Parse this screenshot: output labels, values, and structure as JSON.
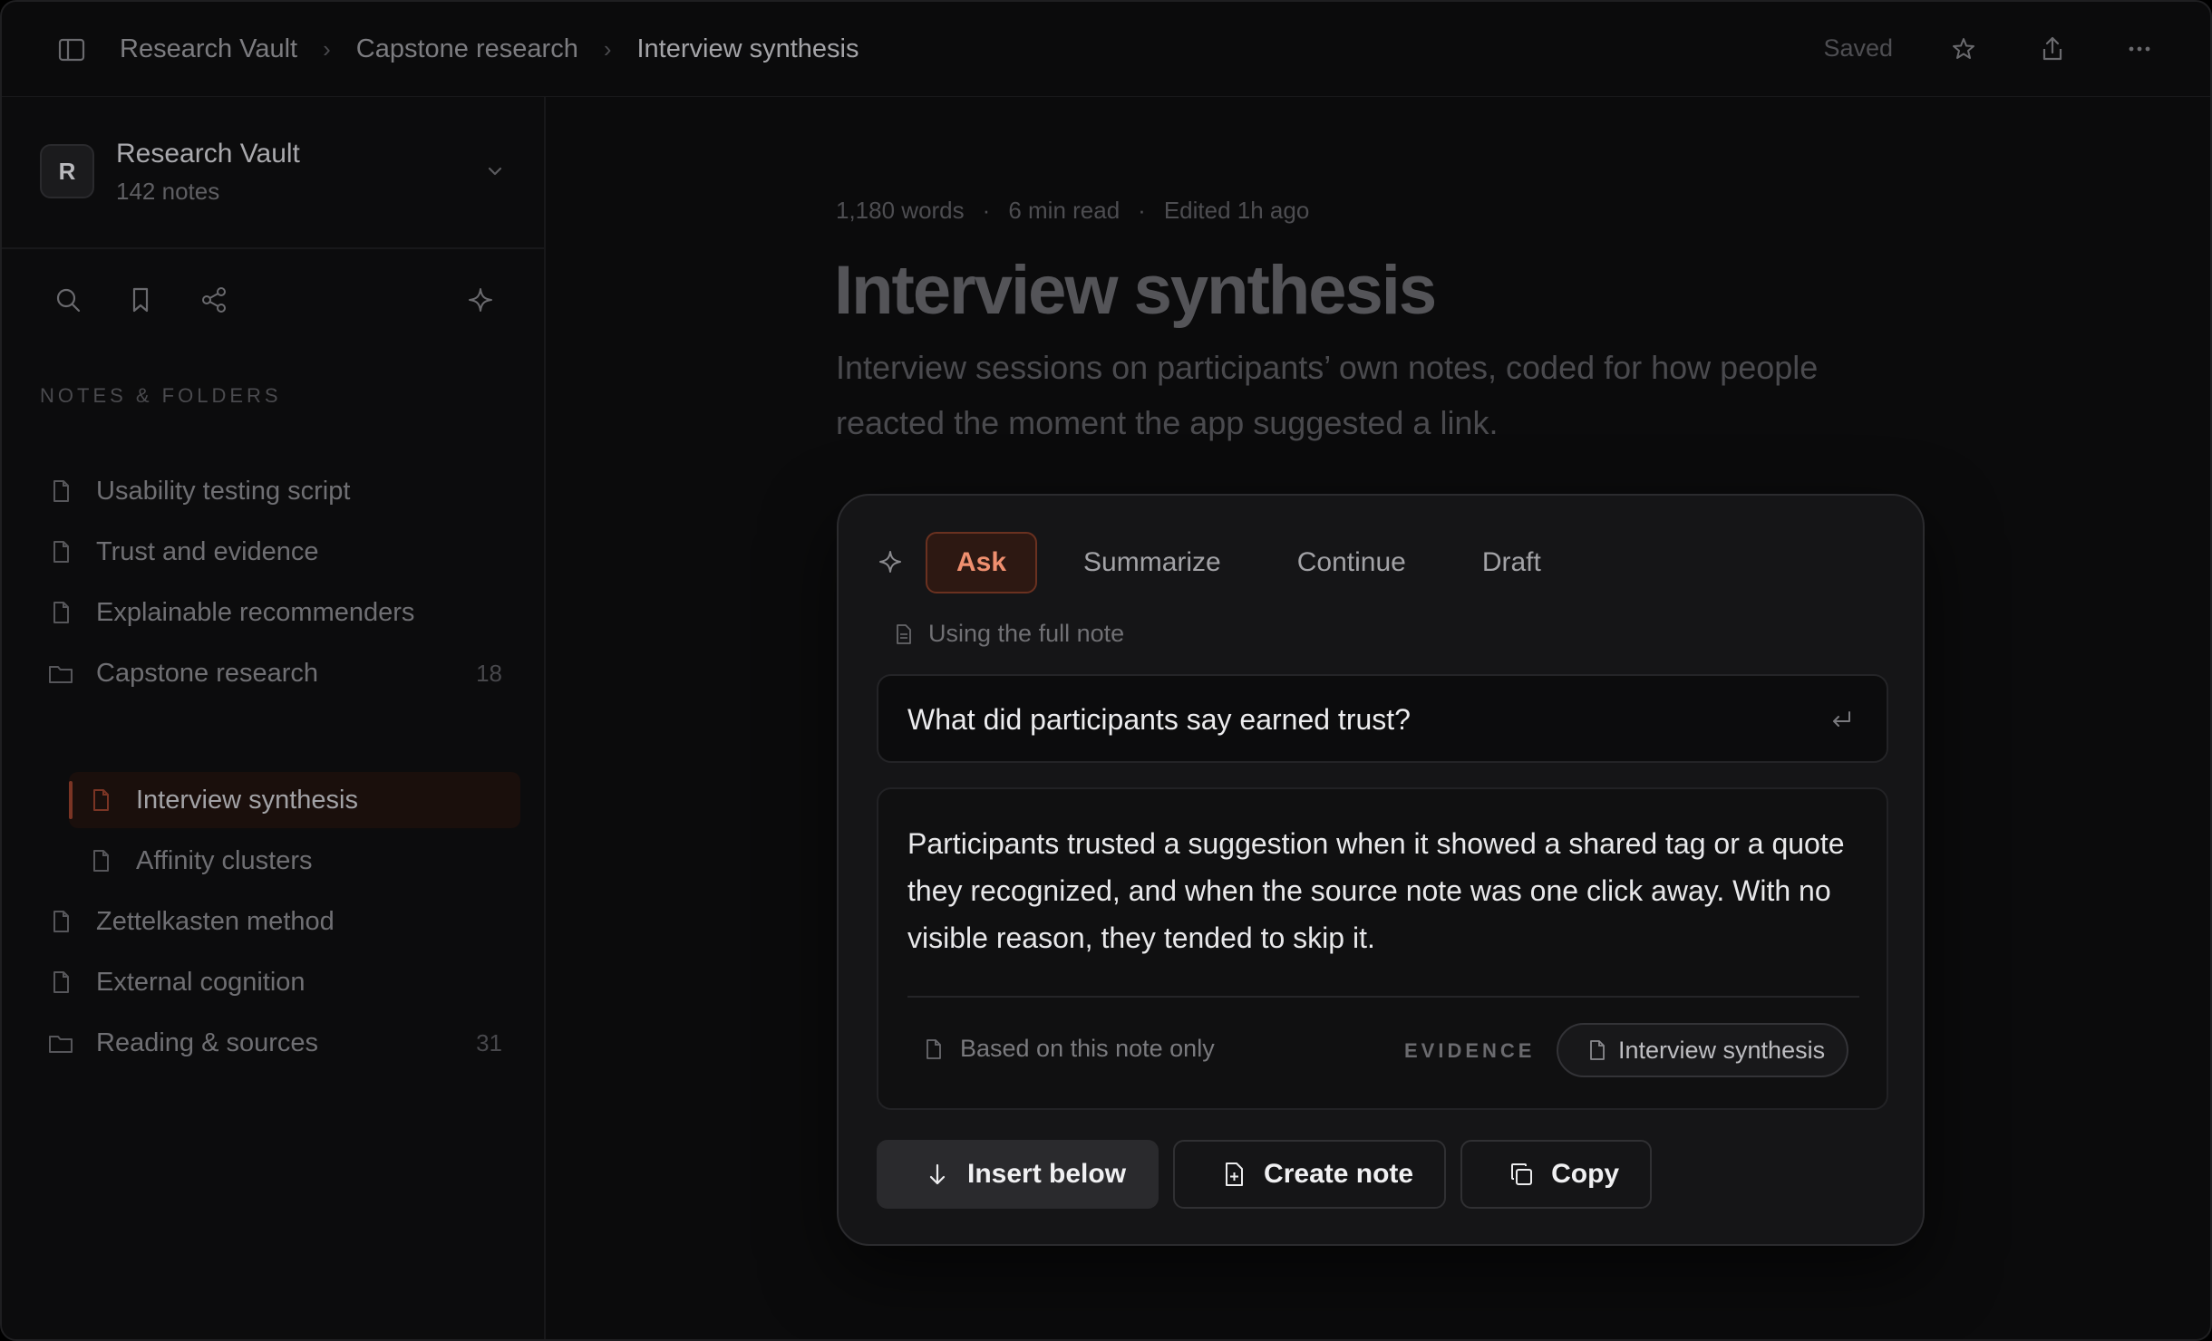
{
  "breadcrumb": [
    "Research Vault",
    "Capstone research",
    "Interview synthesis"
  ],
  "topbar": {
    "saved_label": "Saved",
    "icons": [
      "sidebar-toggle-icon",
      "star-icon",
      "share-icon",
      "more-icon"
    ]
  },
  "sidebar": {
    "vault": {
      "initial": "R",
      "name": "Research Vault",
      "count": "142 notes"
    },
    "tools": [
      "search-icon",
      "bookmark-icon",
      "graph-icon",
      "sparkle-icon"
    ],
    "section_label": "NOTES & FOLDERS",
    "items": [
      {
        "type": "note",
        "label": "Usability testing script"
      },
      {
        "type": "note",
        "label": "Trust and evidence"
      },
      {
        "type": "note",
        "label": "Explainable recommenders"
      },
      {
        "type": "folder",
        "label": "Capstone research",
        "count": "18"
      },
      {
        "type": "note",
        "label": "Interview synthesis",
        "active": true,
        "child": true
      },
      {
        "type": "note",
        "label": "Affinity clusters",
        "child": true
      },
      {
        "type": "note",
        "label": "Zettelkasten method"
      },
      {
        "type": "note",
        "label": "External cognition"
      },
      {
        "type": "folder",
        "label": "Reading & sources",
        "count": "31"
      }
    ]
  },
  "doc": {
    "meta": {
      "words": "1,180 words",
      "read": "6 min read",
      "edited": "Edited 1h ago",
      "separator": "·"
    },
    "title": "Interview synthesis",
    "subtitle": "Interview sessions on participants’ own notes, coded for how people reacted the moment the app suggested a link."
  },
  "ai": {
    "tabs": [
      {
        "label": "Ask",
        "active": true
      },
      {
        "label": "Summarize"
      },
      {
        "label": "Continue"
      },
      {
        "label": "Draft"
      }
    ],
    "context": "Using the full note",
    "query": "What did participants say earned trust?",
    "answer": "Participants trusted a suggestion when it showed a shared tag or a quote they recognized, and when the source note was one click away. With no visible reason, they tended to skip it.",
    "based_on": "Based on this note only",
    "evidence_label": "EVIDENCE",
    "evidence_chip": "Interview synthesis",
    "actions": {
      "insert": "Insert below",
      "create": "Create note",
      "copy": "Copy"
    }
  },
  "colors": {
    "accent": "#ef8f6f",
    "accent_bg": "#2d1812",
    "background": "#0b0b0c",
    "panel": "#151517"
  }
}
